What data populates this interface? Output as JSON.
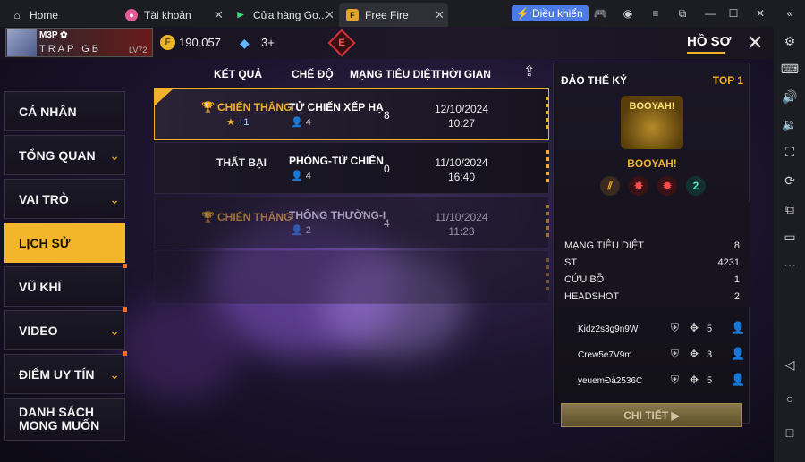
{
  "tabs": {
    "home": "Home",
    "account": "Tài khoản",
    "store": "Cửa hàng Go...",
    "game": "Free Fire"
  },
  "window": {
    "control_label": "Điều khiển"
  },
  "profile": {
    "name": "M3P ✿",
    "clan": "TRAP GB",
    "level": "LV72"
  },
  "currency": {
    "coins": "190.057",
    "diamonds": "3+"
  },
  "rank_badge": "E",
  "header": {
    "title": "HỒ SƠ"
  },
  "nav": [
    {
      "label": "CÁ NHÂN",
      "chevron": false
    },
    {
      "label": "TỔNG QUAN",
      "chevron": true
    },
    {
      "label": "VAI TRÒ",
      "chevron": true
    },
    {
      "label": "LỊCH SỬ",
      "chevron": false
    },
    {
      "label": "VŨ KHÍ",
      "chevron": false
    },
    {
      "label": "VIDEO",
      "chevron": true
    },
    {
      "label": "ĐIỂM UY TÍN",
      "chevron": true
    },
    {
      "label": "DANH SÁCH\nMONG MUỐN",
      "chevron": false
    }
  ],
  "table": {
    "headers": [
      "KẾT QUẢ",
      "CHẾ ĐỘ",
      "MẠNG TIÊU DIỆT",
      "THỜI GIAN"
    ],
    "rows": [
      {
        "result": "CHIẾN THẮNG",
        "star": "★",
        "plus": "+1",
        "mode": "TỬ CHIẾN XẾP HẠ",
        "team": "4",
        "kills": "8",
        "date": "12/10/2024",
        "time": "10:27"
      },
      {
        "result": "THẤT BẠI",
        "star": "",
        "plus": "",
        "mode": "PHÒNG-TỬ CHIẾN",
        "team": "4",
        "kills": "0",
        "date": "11/10/2024",
        "time": "16:40"
      },
      {
        "result": "CHIẾN THẮNG",
        "star": "",
        "plus": "",
        "mode": "THÔNG THƯỜNG-I",
        "team": "2",
        "kills": "4",
        "date": "11/10/2024",
        "time": "11:23"
      }
    ]
  },
  "detail": {
    "map": "ĐẢO THẾ KỶ",
    "rank": "TOP 1",
    "banner": "BOOYAH!",
    "result_label": "BOOYAH!",
    "stats": [
      {
        "label": "MẠNG TIÊU DIỆT",
        "value": "8"
      },
      {
        "label": "ST",
        "value": "4231"
      },
      {
        "label": "CỨU BỒ",
        "value": "1"
      },
      {
        "label": "HEADSHOT",
        "value": "2"
      }
    ],
    "players": [
      {
        "name": "Kidz2s3g9n9W",
        "kills": "5"
      },
      {
        "name": "Crew5e7V9m",
        "kills": "3"
      },
      {
        "name": "yeuemĐà2536C",
        "kills": "5"
      }
    ],
    "button": "CHI TIẾT ▶"
  }
}
